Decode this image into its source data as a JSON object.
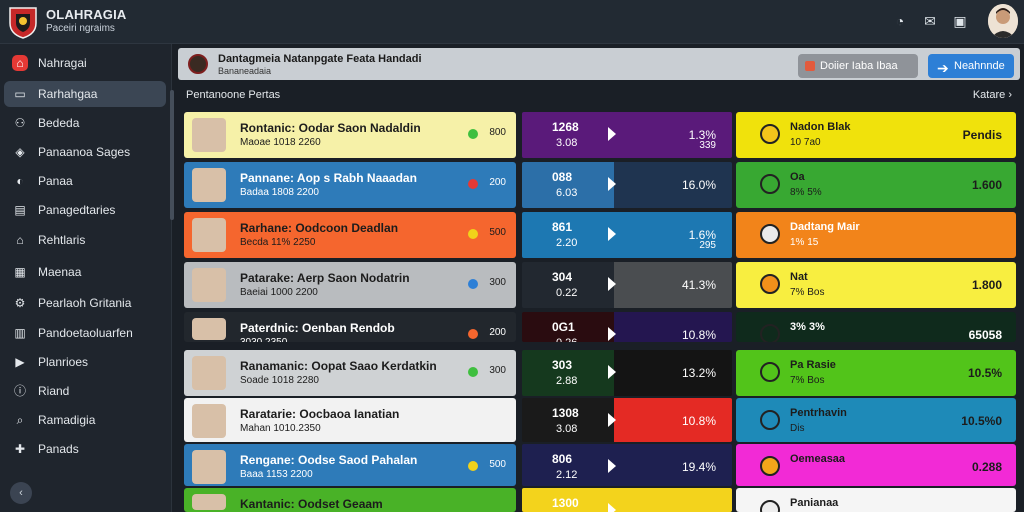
{
  "app": {
    "title": "OLAHRAGIA",
    "subtitle": "Paceiri ngraims"
  },
  "topbar": {
    "icons": [
      "clock-icon",
      "mail-icon",
      "tv-icon"
    ]
  },
  "sidebar": {
    "items": [
      {
        "label": "Nahragai",
        "icon": "home-icon"
      },
      {
        "label": "Rarhahgaa",
        "icon": "monitor-icon"
      },
      {
        "label": "Bededa",
        "icon": "people-icon"
      },
      {
        "label": "Panaanoa Sages",
        "icon": "tag-icon"
      },
      {
        "label": "Panaa",
        "icon": "chart-icon"
      },
      {
        "label": "Panagedtaries",
        "icon": "calendar-icon"
      },
      {
        "label": "Rehtlaris",
        "icon": "bank-icon"
      },
      {
        "label": "Maenaa",
        "icon": "grid-icon"
      },
      {
        "label": "Pearlaoh Gritania",
        "icon": "settings-icon"
      },
      {
        "label": "Pandoetaoluarfen",
        "icon": "table-icon"
      },
      {
        "label": "Planrioes",
        "icon": "play-icon"
      },
      {
        "label": "Riand",
        "icon": "info-icon"
      },
      {
        "label": "Ramadigia",
        "icon": "search-icon"
      },
      {
        "label": "Panads",
        "icon": "apps-icon"
      }
    ]
  },
  "header": {
    "title": "Dantagmeia Natanpgate Feata Handadi",
    "subtitle": "Bananeadaia",
    "secondary_button": "Doiier Iaba   Ibaa",
    "primary_button": "Neahnnde"
  },
  "section": {
    "title": "Pentanoone Pertas",
    "link": "Katare"
  },
  "rows": [
    {
      "name": "Rontanic: Oodar Saon Nadaldin",
      "meta": "Maoae   1018 2260",
      "score": "800",
      "card_bg": "#f6f1a8",
      "card_fg": "#1c1c1c",
      "dot": "#3fbf3f",
      "odd1": "1268",
      "odd2": "3.08",
      "odds_l": "#5a1a7a",
      "odds_r": "#5a1a7a",
      "pct": "1.3%",
      "pct_sub": "339",
      "stat_bg": "#f0e20c",
      "stat_fg": "#1c1c1c",
      "stat_title": "Nadon Blak",
      "stat_sub": "10 7a0",
      "stat_val": "Pendis",
      "icon_bg": "#f3c41b"
    },
    {
      "name": "Pannane: Aop s Rabh Naaadan",
      "meta": "Badaa   1808 2200",
      "score": "200",
      "card_bg": "#2e7bb9",
      "card_fg": "#ffffff",
      "dot": "#e53935",
      "odd1": "088",
      "odd2": "6.03",
      "odds_l": "#2c6fa8",
      "odds_r": "#1f3450",
      "pct": "16.0%",
      "pct_sub": "",
      "stat_bg": "#38a832",
      "stat_fg": "#1c1c1c",
      "stat_title": "Oa",
      "stat_sub": "8% 5%",
      "stat_val": "1.600",
      "icon_bg": "#38a832"
    },
    {
      "name": "Rarhane: Oodcoon Deadlan",
      "meta": "Becda   11% 2250",
      "score": "500",
      "card_bg": "#f5662e",
      "card_fg": "#1c1c1c",
      "dot": "#f1d21a",
      "odd1": "861",
      "odd2": "2.20",
      "odds_l": "#1d78b2",
      "odds_r": "#1d78b2",
      "pct": "1.6%",
      "pct_sub": "295",
      "stat_bg": "#f2841a",
      "stat_fg": "#ffffff",
      "stat_title": "Dadtang Mair",
      "stat_sub": "1% 15",
      "stat_val": "",
      "icon_bg": "#eaeaea"
    },
    {
      "name": "Patarake: Aerp Saon Nodatrin",
      "meta": "Baeiai   1000 2200",
      "score": "300",
      "card_bg": "#b9bcbf",
      "card_fg": "#1c1c1c",
      "dot": "#2d7fd6",
      "odd1": "304",
      "odd2": "0.22",
      "odds_l": "#222830",
      "odds_r": "#4a4d50",
      "pct": "41.3%",
      "pct_sub": "",
      "stat_bg": "#f8ee40",
      "stat_fg": "#1c1c1c",
      "stat_title": "Nat",
      "stat_sub": "7% Bos",
      "stat_val": "1.800",
      "icon_bg": "#f2901a"
    },
    {
      "name": "Paterdnic: Oenban Rendob",
      "meta": "3030.2350",
      "score": "200",
      "card_bg": "#22272d",
      "card_fg": "#ffffff",
      "dot": "#f5662e",
      "odd1": "0G1",
      "odd2": "0.26",
      "odds_l": "#2a0c10",
      "odds_r": "#241650",
      "pct": "10.8%",
      "pct_sub": "",
      "stat_bg": "#0f2a1c",
      "stat_fg": "#ffffff",
      "stat_title": "3% 3%",
      "stat_sub": "",
      "stat_val": "65058",
      "icon_bg": "#0f2a1c"
    },
    {
      "name": "Ranamanic: Oopat Saao Kerdatkin",
      "meta": "Soade   1018 2280",
      "score": "300",
      "card_bg": "#cfd2d4",
      "card_fg": "#1c1c1c",
      "dot": "#3fbf3f",
      "odd1": "303",
      "odd2": "2.88",
      "odds_l": "#15391e",
      "odds_r": "#141414",
      "pct": "13.2%",
      "pct_sub": "",
      "stat_bg": "#52c41a",
      "stat_fg": "#1c1c1c",
      "stat_title": "Pa Rasie",
      "stat_sub": "7% Bos",
      "stat_val": "10.5%",
      "icon_bg": "#52c41a"
    },
    {
      "name": "Raratarie: Oocbaoa Ianatian",
      "meta": "Mahan   1010.2350",
      "score": "",
      "card_bg": "#f2f2f2",
      "card_fg": "#1c1c1c",
      "dot": "",
      "odd1": "1308",
      "odd2": "3.08",
      "odds_l": "#1a1a1a",
      "odds_r": "#e42a24",
      "pct": "10.8%",
      "pct_sub": "",
      "stat_bg": "#1e8ab8",
      "stat_fg": "#1c1c1c",
      "stat_title": "Pentrhavin",
      "stat_sub": "Dis",
      "stat_val": "10.5%0",
      "icon_bg": "#1e8ab8"
    },
    {
      "name": "Rengane: Oodse Saod Pahalan",
      "meta": "Baaa   1153 2200",
      "score": "500",
      "card_bg": "#2e7bb9",
      "card_fg": "#ffffff",
      "dot": "#f1d21a",
      "odd1": "806",
      "odd2": "2.12",
      "odds_l": "#1e2050",
      "odds_r": "#1e2050",
      "pct": "19.4%",
      "pct_sub": "",
      "stat_bg": "#f22ad6",
      "stat_fg": "#1c1c1c",
      "stat_title": "Oemeasaa",
      "stat_sub": "",
      "stat_val": "0.288",
      "icon_bg": "#f2a71a"
    },
    {
      "name": "Kantanic: Oodset Geaam",
      "meta": "",
      "score": "",
      "card_bg": "#49b227",
      "card_fg": "#1c1c1c",
      "dot": "",
      "odd1": "1300",
      "odd2": "",
      "odds_l": "#f3d31c",
      "odds_r": "#f3d31c",
      "pct": "",
      "pct_sub": "",
      "stat_bg": "#f5f5f5",
      "stat_fg": "#1c1c1c",
      "stat_title": "Panianaa",
      "stat_sub": "",
      "stat_val": "",
      "icon_bg": "#eeeeee"
    }
  ]
}
